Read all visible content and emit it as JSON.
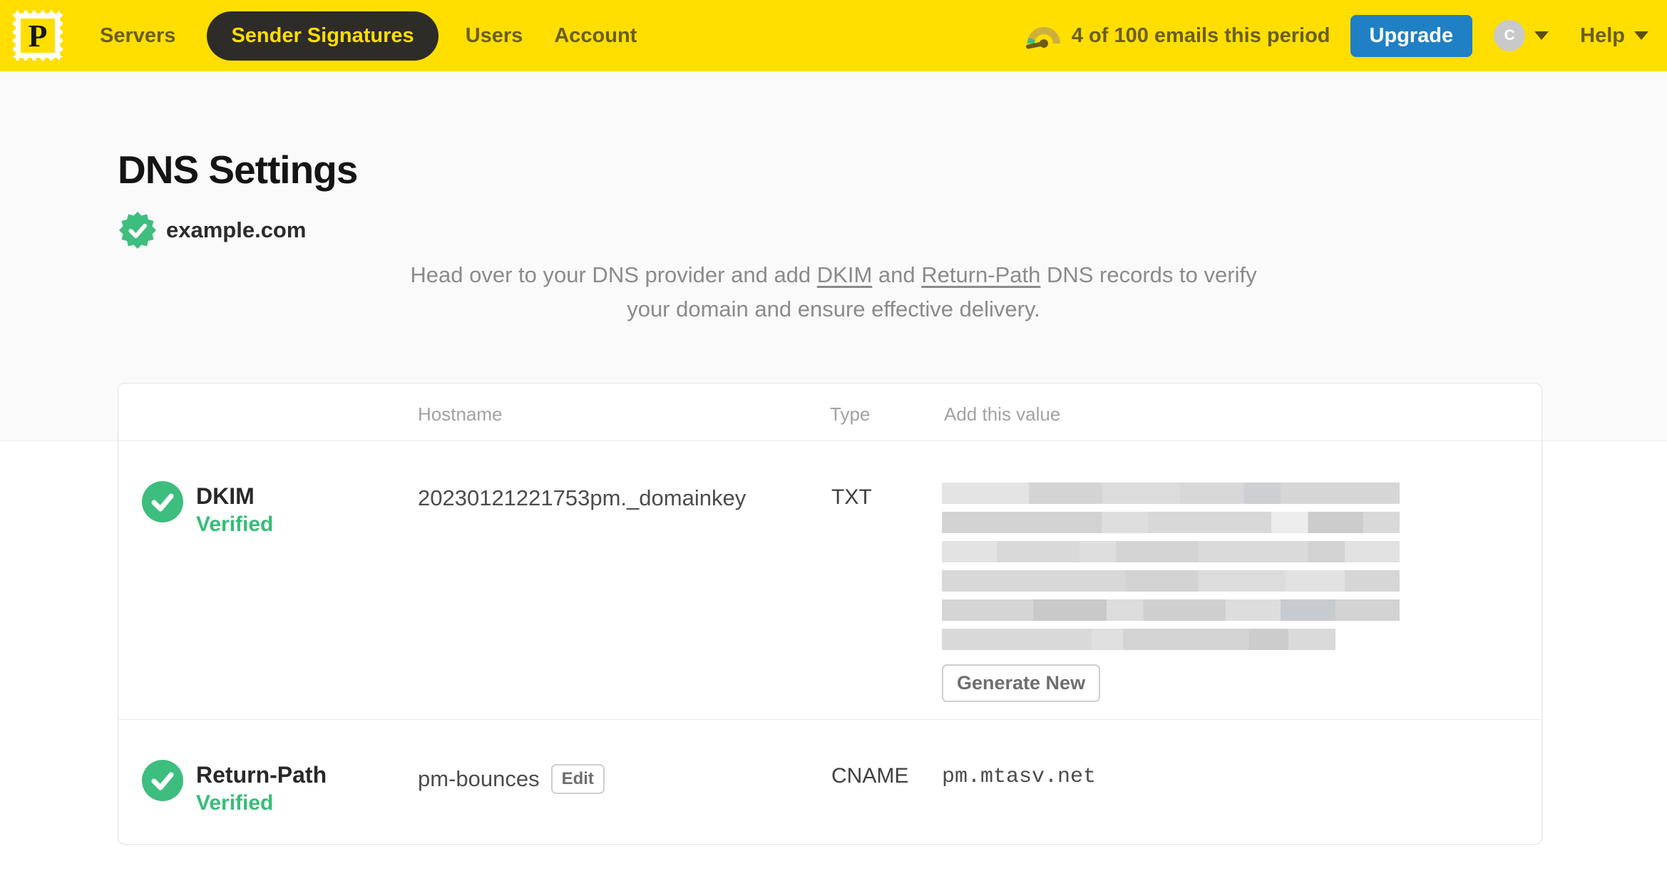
{
  "nav": {
    "logo_letter": "P",
    "items": [
      {
        "label": "Servers",
        "active": false
      },
      {
        "label": "Sender Signatures",
        "active": true
      },
      {
        "label": "Users",
        "active": false
      },
      {
        "label": "Account",
        "active": false
      }
    ],
    "usage_text": "4 of 100 emails this period",
    "upgrade_label": "Upgrade",
    "avatar_initial": "C",
    "help_label": "Help"
  },
  "page": {
    "title": "DNS Settings",
    "domain": "example.com",
    "domain_status": "verified",
    "description": {
      "intro": "Head over to your DNS provider and add ",
      "link_dkim": "DKIM",
      "middle": " and ",
      "link_return_path": "Return-Path",
      "outro": " DNS records to verify your domain and ensure effective delivery."
    }
  },
  "table": {
    "headers": {
      "hostname": "Hostname",
      "type": "Type",
      "value": "Add this value"
    },
    "rows": [
      {
        "name": "DKIM",
        "status": "Verified",
        "hostname": "20230121221753pm._domainkey",
        "type": "TXT",
        "value_redacted": true,
        "action_label": "Generate New"
      },
      {
        "name": "Return-Path",
        "status": "Verified",
        "hostname": "pm-bounces",
        "edit_label": "Edit",
        "type": "CNAME",
        "value": "pm.mtasv.net"
      }
    ]
  },
  "icons": {
    "logo": "postmark-stamp",
    "usage": "gauge",
    "domain_badge": "verified-seal",
    "row_status": "check-circle",
    "menu_caret": "caret-down"
  },
  "colors": {
    "brand_yellow": "#FFDE00",
    "nav_text": "#6A5E1D",
    "nav_active_bg": "#2D2C29",
    "upgrade_blue": "#1F80C5",
    "success_green": "#3DBE7E",
    "description_gray": "#8B8B8B"
  }
}
